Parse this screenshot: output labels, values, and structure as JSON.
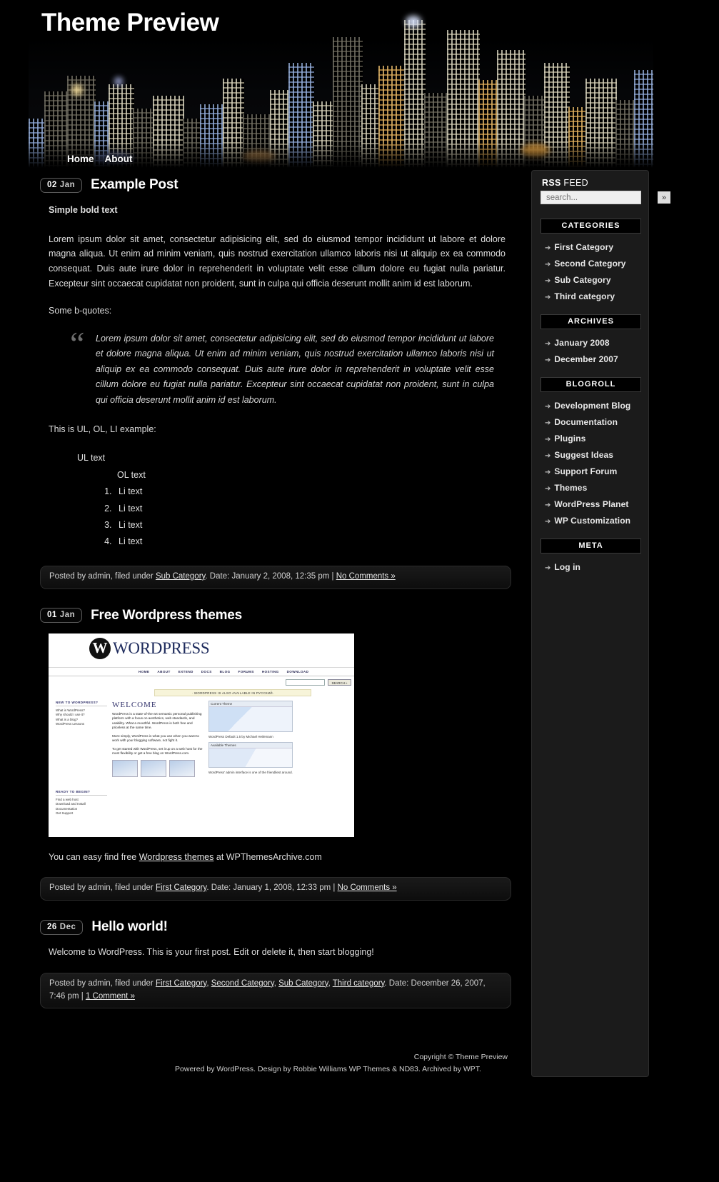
{
  "site": {
    "title": "Theme Preview",
    "nav": [
      {
        "label": "Home"
      },
      {
        "label": "About"
      }
    ]
  },
  "posts": [
    {
      "date_day": "02",
      "date_month": "Jan",
      "title": "Example Post",
      "lead": "Simple bold text",
      "paragraph1": "Lorem ipsum dolor sit amet, consectetur adipisicing elit, sed do eiusmod tempor incididunt ut labore et dolore magna aliqua. Ut enim ad minim veniam, quis nostrud exercitation ullamco laboris nisi ut aliquip ex ea commodo consequat. Duis aute irure dolor in reprehenderit in voluptate velit esse cillum dolore eu fugiat nulla pariatur. Excepteur sint occaecat cupidatat non proident, sunt in culpa qui officia deserunt mollit anim id est laborum.",
      "paragraph2": "Some b-quotes:",
      "blockquote": "Lorem ipsum dolor sit amet, consectetur adipisicing elit, sed do eiusmod tempor incididunt ut labore et dolore magna aliqua. Ut enim ad minim veniam, quis nostrud exercitation ullamco laboris nisi ut aliquip ex ea commodo consequat. Duis aute irure dolor in reprehenderit in voluptate velit esse cillum dolore eu fugiat nulla pariatur. Excepteur sint occaecat cupidatat non proident, sunt in culpa qui officia deserunt mollit anim id est laborum.",
      "list_intro": "This is UL, OL, LI example:",
      "ul_text": "UL text",
      "ol_text": "OL text",
      "li_items": [
        "Li text",
        "Li text",
        "Li text",
        "Li text"
      ],
      "meta": {
        "prefix": "Posted by admin, filed under ",
        "categories": [
          "Sub Category"
        ],
        "date": ". Date: January 2, 2008, 12:35 pm | ",
        "comments": "No Comments »"
      }
    },
    {
      "date_day": "01",
      "date_month": "Jan",
      "title": "Free Wordpress themes",
      "caption_before": "You can easy find free ",
      "caption_link": "Wordpress themes",
      "caption_after": " at WPThemesArchive.com",
      "meta": {
        "prefix": "Posted by admin, filed under ",
        "categories": [
          "First Category"
        ],
        "date": ". Date: January 1, 2008, 12:33 pm | ",
        "comments": "No Comments »"
      }
    },
    {
      "date_day": "26",
      "date_month": "Dec",
      "title": "Hello world!",
      "paragraph1": "Welcome to WordPress. This is your first post. Edit or delete it, then start blogging!",
      "meta": {
        "prefix": "Posted by admin, filed under ",
        "categories": [
          "First Category",
          "Second Category",
          "Sub Category",
          "Third category"
        ],
        "date": ". Date: December 26, 2007, 7:46 pm | ",
        "comments": "1 Comment »"
      }
    }
  ],
  "screenshot": {
    "brand_mark": "W",
    "brand_word": "WORDPRESS",
    "nav": [
      "HOME",
      "ABOUT",
      "EXTEND",
      "DOCS",
      "BLOG",
      "FORUMS",
      "HOSTING",
      "DOWNLOAD"
    ],
    "search_button": "SEARCH »",
    "notice": "· WORDPRESS IS ALSO AVAILABLE IN РУССКИЙ.",
    "left_heading_1": "NEW TO WORDPRESS?",
    "left_links_1": [
      "What is WordPress?",
      "Why should I use it?",
      "What is a blog?",
      "WordPress Lessons"
    ],
    "left_heading_2": "READY TO BEGIN?",
    "left_links_2": [
      "Find a web host",
      "Download and Install",
      "Documentation",
      "Get Support"
    ],
    "welcome": "WELCOME",
    "body_1": "WordPress is a state-of-the-art semantic personal publishing platform with a focus on aesthetics, web standards, and usability. What a mouthful. WordPress is both free and priceless at the same time.",
    "body_2": "More simply, WordPress is what you use when you want to work with your blogging software, not fight it.",
    "body_3": "To get started with WordPress, set it up on a web host for the most flexibility or get a free blog on WordPress.com.",
    "panel_1_title": "Current Theme",
    "panel_1_caption": "WordPress Default 1.5 by Michael Heilemann",
    "panel_2_title": "Available Themes",
    "right_caption": "WordPress' admin interface is one of the friendliest around."
  },
  "sidebar": {
    "rss_bold": "RSS",
    "rss_light": " FEED",
    "search_placeholder": "search...",
    "search_value": "",
    "search_button": "»",
    "sections": [
      {
        "heading": "CATEGORIES",
        "items": [
          "First Category",
          "Second Category",
          "Sub Category",
          "Third category"
        ]
      },
      {
        "heading": "ARCHIVES",
        "items": [
          "January 2008",
          "December 2007"
        ]
      },
      {
        "heading": "BLOGROLL",
        "items": [
          "Development Blog",
          "Documentation",
          "Plugins",
          "Suggest Ideas",
          "Support Forum",
          "Themes",
          "WordPress Planet",
          "WP Customization"
        ]
      },
      {
        "heading": "META",
        "items": [
          "Log in"
        ]
      }
    ]
  },
  "footer": {
    "copyright": "Copyright © Theme Preview",
    "credits": "Powered by WordPress. Design by Robbie Williams WP Themes & ND83. Archived by WPT."
  }
}
